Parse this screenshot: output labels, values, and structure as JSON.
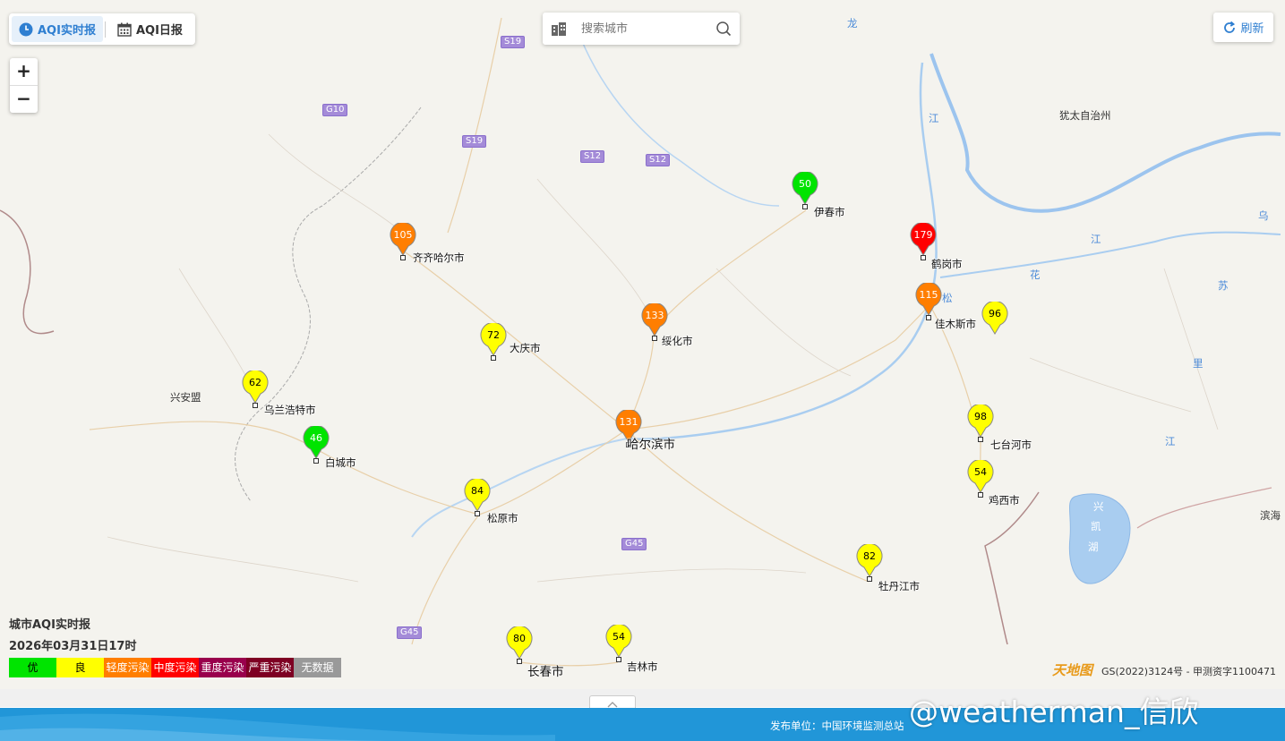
{
  "modes": {
    "realtime": "AQI实时报",
    "daily": "AQI日报"
  },
  "zoom": {
    "in": "+",
    "out": "−"
  },
  "search": {
    "placeholder": "搜索城市"
  },
  "refresh": {
    "label": "刷新"
  },
  "info": {
    "title": "城市AQI实时报",
    "time": "2026年03月31日17时"
  },
  "legend": [
    {
      "label": "优",
      "color": "#00e400",
      "text_color": "#000000"
    },
    {
      "label": "良",
      "color": "#ffff00",
      "text_color": "#000000"
    },
    {
      "label": "轻度污染",
      "color": "#ff7e00",
      "text_color": "#ffffff"
    },
    {
      "label": "中度污染",
      "color": "#ff0000",
      "text_color": "#ffffff"
    },
    {
      "label": "重度污染",
      "color": "#99004c",
      "text_color": "#ffffff"
    },
    {
      "label": "严重污染",
      "color": "#7e0023",
      "text_color": "#ffffff"
    },
    {
      "label": "无数据",
      "color": "#999999",
      "text_color": "#ffffff"
    }
  ],
  "stations": [
    {
      "aqi": "105",
      "city": "齐齐哈尔市",
      "level": "orange"
    },
    {
      "aqi": "50",
      "city": "伊春市",
      "level": "green"
    },
    {
      "aqi": "179",
      "city": "鹤岗市",
      "level": "red"
    },
    {
      "aqi": "115",
      "city": "佳木斯市",
      "level": "orange"
    },
    {
      "aqi": "96",
      "city": "",
      "level": "yellow"
    },
    {
      "aqi": "133",
      "city": "绥化市",
      "level": "orange"
    },
    {
      "aqi": "72",
      "city": "大庆市",
      "level": "yellow"
    },
    {
      "aqi": "62",
      "city": "乌兰浩特市",
      "level": "yellow"
    },
    {
      "aqi": "46",
      "city": "白城市",
      "level": "green"
    },
    {
      "aqi": "131",
      "city": "哈尔滨市",
      "level": "orange"
    },
    {
      "aqi": "98",
      "city": "七台河市",
      "level": "yellow"
    },
    {
      "aqi": "54",
      "city": "鸡西市",
      "level": "yellow"
    },
    {
      "aqi": "84",
      "city": "松原市",
      "level": "yellow"
    },
    {
      "aqi": "82",
      "city": "牡丹江市",
      "level": "yellow"
    },
    {
      "aqi": "80",
      "city": "长春市",
      "level": "yellow"
    },
    {
      "aqi": "54",
      "city": "吉林市",
      "level": "yellow"
    }
  ],
  "places": {
    "xinganmeng": "兴安盟",
    "youtai": "犹太自治州",
    "binhai": "滨海"
  },
  "rivers": {
    "long": "龙",
    "jiang1": "江",
    "jiang2": "江",
    "hua": "花",
    "song": "松",
    "wu": "乌",
    "su": "苏",
    "li": "里",
    "jiang3": "江",
    "xing": "兴",
    "kai": "凯",
    "hu": "湖"
  },
  "highways": {
    "s19a": "S19",
    "g10": "G10",
    "s19b": "S19",
    "s12a": "S12",
    "s12b": "S12",
    "g45a": "G45",
    "g45b": "G45"
  },
  "map_logo": "天地图",
  "copyright": "GS(2022)3124号 - 甲测资字1100471",
  "footer": {
    "publisher": "发布单位：中国环境监测总站"
  },
  "watermark": "@weatherman_信欣",
  "level_colors": {
    "green": "#00e400",
    "yellow": "#ffff00",
    "orange": "#ff7e00",
    "red": "#ff0000"
  }
}
